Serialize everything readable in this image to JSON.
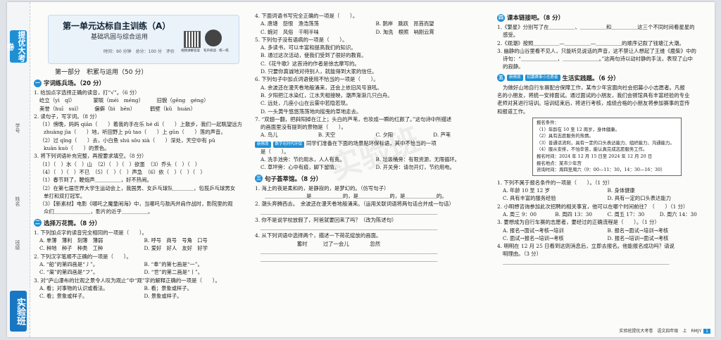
{
  "spine": {
    "tab_top": "提优大考卷",
    "tab_bottom": "实验班",
    "fields": [
      "学号",
      "姓名",
      "班级"
    ]
  },
  "header": {
    "title": "第一单元达标自主训练（A）",
    "subtitle": "基础巩固与综合运用",
    "meta": "时间：90 分钟　总分：100 分　评价",
    "qr_caption_1": "视频讲解答案",
    "qr_caption_2": "有声阅读 · 练一练"
  },
  "part1": "第一部分　积累与运用（50 分）",
  "col1": [
    {
      "type": "sec",
      "n": "一",
      "text": "字词练兵场。（20 分）"
    },
    {
      "type": "line",
      "text": "1. 给加点字选择正确的读音，打“√”。（6 分）"
    },
    {
      "type": "line",
      "cls": "ind",
      "text": "屹立（yì　qǐ）　　　　蒙眬（méi　méng）　　　旧貌（gēng　géng）"
    },
    {
      "type": "line",
      "cls": "ind",
      "text": "美誉（huī　suì）　　　偏僻（bì　bēn）　　　 鹤壁（kǔ　huán）"
    },
    {
      "type": "line",
      "text": "2. 读句子，写字词。（8 分）"
    },
    {
      "type": "line",
      "cls": "ind",
      "text": "（1）傍晚，妈妈 qiān（　　）着我的手在乐 hé dī（　　）上散步，我们一起眺望远方"
    },
    {
      "type": "line",
      "cls": "ind2",
      "text": "zhuàng jìa（　　）地，听田野上 pǔ tao（　　）上 gǔn（　　）落的声音。"
    },
    {
      "type": "line",
      "cls": "ind",
      "text": "（2）过 qǐng（　　）去，小白鱼 shú sǒu xià（　　）深处，天空中有 pǔ"
    },
    {
      "type": "line",
      "cls": "ind2",
      "text": "kuān kuò（　　）的景色。"
    },
    {
      "type": "line",
      "text": "3. 将下列词语补充完整，再按要求填空。（8 分）"
    },
    {
      "type": "line",
      "cls": "ind",
      "text": "（1）（　）水（　）山　（2）（　）（　）欲墨　（3）乔头（　）（　）"
    },
    {
      "type": "line",
      "cls": "ind",
      "text": "（4）（　）（　）不已　（5）（　）（　）声急　（6）依（　）（　）（　）"
    },
    {
      "type": "line",
      "cls": "ind",
      "text": "（1）春节到了，鞭炮声＿＿＿＿＿，好不热闹。"
    },
    {
      "type": "line",
      "cls": "ind",
      "text": "（2）在第七届世界大学生运动会上，我国男、女乒乓球队＿＿＿＿，包揽乒乓球男女"
    },
    {
      "type": "line",
      "cls": "ind2",
      "text": "单打和双打冠军。"
    },
    {
      "type": "line",
      "cls": "ind",
      "text": "（3）【新素材】电影《哪吒之魔童闹海》中，当哪吒与敖丙并肩作战时，影院里的观"
    },
    {
      "type": "line",
      "cls": "ind2",
      "text": "众们＿＿＿＿＿＿＿，影片的近乎＿＿＿＿＿。"
    },
    {
      "type": "sec",
      "n": "二",
      "text": "选择万花筒。（8 分）"
    },
    {
      "type": "line",
      "text": "1. 下列加点字的读音完全相同的一项是（　　）。"
    },
    {
      "type": "opts",
      "items": [
        "A. 单薄　薄利　刻薄　薄弱",
        "B. 呼号　商号　号角　口号"
      ]
    },
    {
      "type": "opts",
      "items": [
        "C. 种地　种子　种类　工种",
        "D. 爱好　好人　友好　好学"
      ]
    },
    {
      "type": "line",
      "text": "2. 下列汉字笔顺不正确的一项是（　　）。"
    },
    {
      "type": "opts",
      "items": [
        "A. “船”的第四画是“丿”。",
        "B. “奉”的第七画是“一”。"
      ]
    },
    {
      "type": "opts",
      "items": [
        "C. “渠”的第四画是“フ”。",
        "D. “世”的第二画是“丨”。"
      ]
    },
    {
      "type": "line",
      "text": "3. 对“庐山瀑布的壮观之景令人叹为观止”中“观”字的解释正确的一项是（　　）。"
    },
    {
      "type": "opts",
      "items": [
        "A. 看；对事物的认识或看法。",
        "B. 看；景象或样子。"
      ]
    },
    {
      "type": "opts",
      "items": [
        "C. 看；景象或样子。",
        "D. 景象或样子。"
      ]
    }
  ],
  "col2": [
    {
      "type": "line",
      "text": "4. 下面词语书写完全正确的一项是（　　）。"
    },
    {
      "type": "opts",
      "items": [
        "A. 唐塘　怨恨　渔浩荡荡",
        "B. 鹅岸　跳跃　昂首而望"
      ]
    },
    {
      "type": "opts",
      "items": [
        "C. 蜿对　风俗　千明半味",
        "D. 淘洗　根照　呐刚云霄"
      ]
    },
    {
      "type": "line",
      "text": "5. 下列句子没有语病的一项是（　　）。"
    },
    {
      "type": "line",
      "cls": "ind",
      "text": "A. 多读书，可以丰富和提高我们的知识。"
    },
    {
      "type": "line",
      "cls": "ind",
      "text": "B. 通过这次活动，使我们受到了很好的教育。"
    },
    {
      "type": "line",
      "cls": "ind",
      "text": "C.《花牛歌》这首诗的作者是徐志摩写的。"
    },
    {
      "type": "line",
      "cls": "ind",
      "text": "D. 只要你真诚地对待别人，就能得到大家的信任。"
    },
    {
      "type": "line",
      "text": "6. 下列句子中加点词语使用不恰当的一项是（　　）。"
    },
    {
      "type": "line",
      "cls": "ind",
      "text": "A. 余波还在漫天卷地般涌来，还会上依旧风号浪吼。"
    },
    {
      "type": "line",
      "cls": "ind",
      "text": "B. 夕阳把江水染红，江水天相接映，潮声渐渐几只白舟。"
    },
    {
      "type": "line",
      "cls": "ind",
      "text": "C. 远处，几座小山在云雾中若隐若现。"
    },
    {
      "type": "line",
      "cls": "ind",
      "text": "D. 一头黄牛悠悠荡荡地向摇曳的草地走去。"
    },
    {
      "type": "line",
      "text": "7. “双翅一翻，把斜阳掉在江上；头白的芦苇，也妆成一瞬的红颜了。”这句诗中所描述"
    },
    {
      "type": "line",
      "cls": "ind",
      "text": "的画面里没有提到的景物是（　　）。"
    },
    {
      "type": "opts",
      "items": [
        "A. 鸟儿",
        "B. 天空",
        "C. 夕阳",
        "D. 芦苇"
      ]
    },
    {
      "type": "line",
      "tag": "新情境",
      "tag2": "数字化时代环保",
      "text": "同学们准备在下面的场景贴环保标语，其中不恰当的一项"
    },
    {
      "type": "line",
      "cls": "ind",
      "text": "是（　　）。"
    },
    {
      "type": "opts",
      "items": [
        "A. 洗手池旁：节约用水，人人有责。",
        "B. 垃圾桶旁：有限资源，无限循环。"
      ]
    },
    {
      "type": "opts",
      "items": [
        "C. 草坪旁：心中有痕，脚下留情。",
        "D. 开关旁：请勿开灯，节约用电。"
      ]
    },
    {
      "type": "sec",
      "n": "三",
      "text": "句子荟萃馆。（8 分）"
    },
    {
      "type": "line",
      "text": "1. 海上的夜是柔和的，是静寂的，是梦幻的。（仿写句子）"
    },
    {
      "type": "line",
      "cls": "ind2",
      "text": "＿＿＿＿＿＿＿＿是＿＿＿＿＿＿的，是＿＿＿＿＿＿的，是＿＿＿＿＿＿的。"
    },
    {
      "type": "line",
      "text": "2. 潮头奔腾西去。　余波还在漫天卷地般涌来。（运用关联词语将两句话合并成一句话）"
    },
    {
      "type": "line",
      "cls": "ind",
      "text": "＿＿＿＿＿＿＿＿＿＿＿＿＿＿＿＿＿＿＿＿＿＿＿＿＿＿＿＿＿＿＿＿＿＿"
    },
    {
      "type": "line",
      "text": "3. 你不是说学校放假了，阿爸就要回来了吗？（改为陈述句）"
    },
    {
      "type": "line",
      "cls": "ind",
      "text": "＿＿＿＿＿＿＿＿＿＿＿＿＿＿＿＿＿＿＿＿＿＿＿＿＿＿＿＿＿＿＿＿＿＿"
    },
    {
      "type": "line",
      "text": "4. 从下列词语中选择两个，描述一下荷花绽放的画面。"
    },
    {
      "type": "line",
      "cls": "ind",
      "text": "　　　　　　　蓄时　　　过了一会儿　　　　忽然"
    },
    {
      "type": "line",
      "cls": "ind",
      "text": "＿＿＿＿＿＿＿＿＿＿＿＿＿＿＿＿＿＿＿＿＿＿＿＿＿＿＿＿＿＿＿＿＿＿"
    },
    {
      "type": "line",
      "cls": "ind",
      "text": "＿＿＿＿＿＿＿＿＿＿＿＿＿＿＿＿＿＿＿＿＿＿＿＿＿＿＿＿＿＿＿＿＿＿"
    }
  ],
  "col3": [
    {
      "type": "sec",
      "n": "四",
      "text": "课本链接吧。（8 分）"
    },
    {
      "type": "line",
      "text": "1.《繁星》分别写了在＿＿＿＿＿、＿＿＿＿＿和＿＿＿＿＿这三个不同时间看星星的"
    },
    {
      "type": "line",
      "cls": "ind",
      "text": "感受。"
    },
    {
      "type": "line",
      "text": "2.《观潮》按照＿＿＿＿＿—＿＿＿＿＿—＿＿＿＿＿的顺序记叙了钱塘江大潮。"
    },
    {
      "type": "line",
      "text": "3. 幽静的山谷里看不见人，只能听见说话的声音，这不禁让人想起了王维《鹿柴》中的"
    },
    {
      "type": "line",
      "cls": "ind",
      "text": "诗句：“＿＿＿＿＿＿＿，＿＿＿＿＿＿＿。”这两句诗以动衬静的手法，表现了山中"
    },
    {
      "type": "line",
      "cls": "ind",
      "text": "的寂静。"
    },
    {
      "type": "sec",
      "n": "五",
      "tag": "新情境",
      "tag2": "招募赛事小志愿者",
      "text": "生活实践题。（6 分）"
    },
    {
      "type": "line",
      "cls": "ind",
      "text": "为做好山地自行车赛配合保障工作，某市少年宫面向社会招募小小志愿者。凡报"
    },
    {
      "type": "line",
      "text": "名的小朋友，将统一安排面试。通过面试的小朋友，我们会驿馆具有丰富经验的专业"
    },
    {
      "type": "line",
      "text": "老师对其进行培训。培训结束后，将进行考核，成绩合格的小朋友将参加赛事的宣传"
    },
    {
      "type": "line",
      "text": "和报道工作。"
    },
    {
      "type": "box",
      "items": [
        "报名条件：",
        "（1）年龄在 10 至 12 周岁，身体健康。",
        "（2）具有志愿服务的热情。",
        "（3）普通话流利，具有一定的口头表达能力、组织能力、沟通能力。",
        "（4）服从安排，不怕辛苦，能认真完成志愿服务工作。",
        "报名时间：2024 年 12 月 15 日至 2024 年 12 月 20 日",
        "报名地点：某市少年宫",
        "咨询时间：周四至周六（9：00—11：30，14：30—16：30）"
      ]
    },
    {
      "type": "line",
      "text": "1. 下列不属于报名条件的一项是（　　）。（1 分）"
    },
    {
      "type": "opts",
      "items": [
        "A. 年龄 10 至 12 岁",
        "B. 身体健康"
      ]
    },
    {
      "type": "opts",
      "items": [
        "C. 具有丰富的服务经验",
        "D. 具有一定的口头表达能力"
      ]
    },
    {
      "type": "line",
      "text": "2. 小明想咨询参加此次招聘的相关事宜，他可以在哪个时间前往？（　　）（1 分）"
    },
    {
      "type": "opts",
      "items": [
        "A. 周三 9：00",
        "B. 周四 13：30",
        "C. 周五 17：30",
        "D. 周六 14：30"
      ]
    },
    {
      "type": "line",
      "text": "3. 要想成为自行车赛的志愿者，要经过的正确流程是（　　）。（1 分）"
    },
    {
      "type": "opts",
      "items": [
        "A. 报名→面试→考核→培训",
        "B. 报名→面试→培训→考核"
      ]
    },
    {
      "type": "opts",
      "items": [
        "C. 面试→报名→培训→考核",
        "D. 报名→培训→面试→考核"
      ]
    },
    {
      "type": "line",
      "text": "4. 明明在 12 月 25 日看到这则消息后，立即去报名。他能报名成功吗？请说"
    },
    {
      "type": "line",
      "cls": "ind",
      "text": "明理由。（3 分）"
    },
    {
      "type": "line",
      "cls": "ind",
      "text": "＿＿＿＿＿＿＿＿＿＿＿＿＿＿＿＿＿＿＿＿＿＿＿＿＿＿＿＿＿＿＿＿"
    }
  ],
  "footer": {
    "text": "实验班提优大考卷　语文四年级　上　RMJY",
    "page": "1"
  },
  "watermark": "实验班"
}
